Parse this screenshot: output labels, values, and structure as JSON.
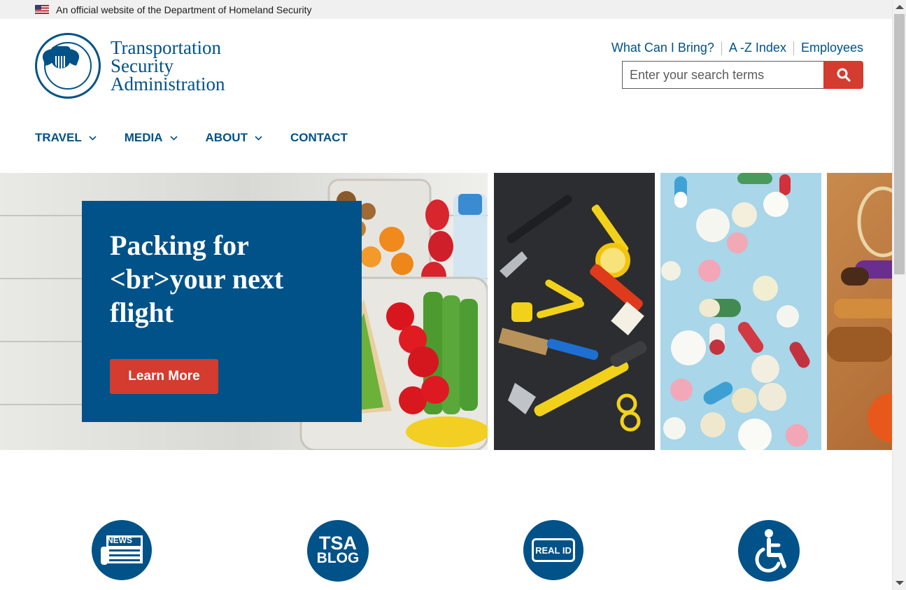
{
  "gov_banner": {
    "text": "An official website of the Department of Homeland Security"
  },
  "logo": {
    "line1": "Transportation",
    "line2": "Security",
    "line3": "Administration",
    "seal_icon": "dhs-seal-icon"
  },
  "utility_links": [
    {
      "label": "What Can I Bring?"
    },
    {
      "label": "A -Z Index"
    },
    {
      "label": "Employees"
    }
  ],
  "search": {
    "placeholder": "Enter your search terms",
    "value": "",
    "icon": "search-icon"
  },
  "nav": [
    {
      "label": "TRAVEL",
      "has_dropdown": true
    },
    {
      "label": "MEDIA",
      "has_dropdown": true
    },
    {
      "label": "ABOUT",
      "has_dropdown": true
    },
    {
      "label": "CONTACT",
      "has_dropdown": false
    }
  ],
  "hero": {
    "title": "Packing for <br>your next flight",
    "cta_label": "Learn More",
    "panels": [
      "food-image",
      "tools-image",
      "pills-image",
      "sports-image"
    ]
  },
  "quick_links": [
    {
      "icon": "news-icon",
      "label": "NEWS"
    },
    {
      "icon": "tsa-blog-icon",
      "label_line1": "TSA",
      "label_line2": "BLOG"
    },
    {
      "icon": "real-id-icon",
      "label": "REAL ID"
    },
    {
      "icon": "accessibility-icon"
    }
  ],
  "colors": {
    "brand_blue": "#005288",
    "accent_red": "#d33c2f",
    "banner_gray": "#f0f0f0"
  }
}
